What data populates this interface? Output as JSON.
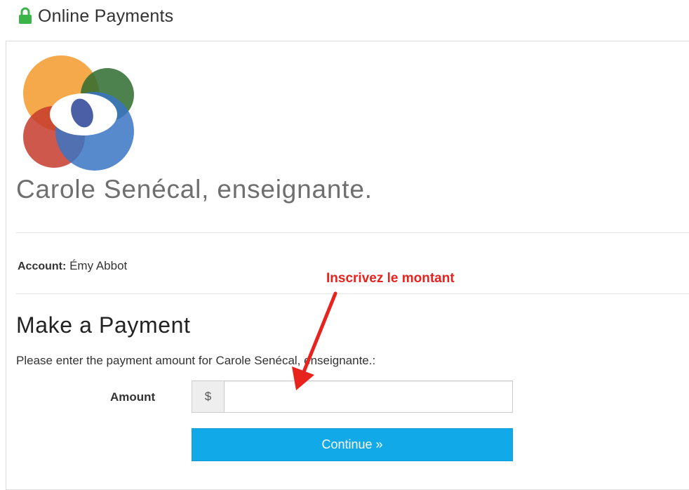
{
  "header": {
    "title": "Online Payments",
    "icon": "lock-icon",
    "icon_color": "#3bb44a"
  },
  "business": {
    "name": "Carole Senécal, enseignante.",
    "logo_icon": "overlapping-circles-logo"
  },
  "account": {
    "label": "Account:",
    "value": "Émy Abbot"
  },
  "annotation": {
    "text": "Inscrivez le montant",
    "color": "#e8231d",
    "icon": "arrow-icon"
  },
  "payment": {
    "heading": "Make a Payment",
    "instruction": "Please enter the payment amount for Carole Senécal, enseignante.:",
    "amount_label": "Amount",
    "currency_symbol": "$",
    "amount_value": "",
    "amount_placeholder": "",
    "continue_label": "Continue »",
    "button_color": "#11a9e7"
  }
}
